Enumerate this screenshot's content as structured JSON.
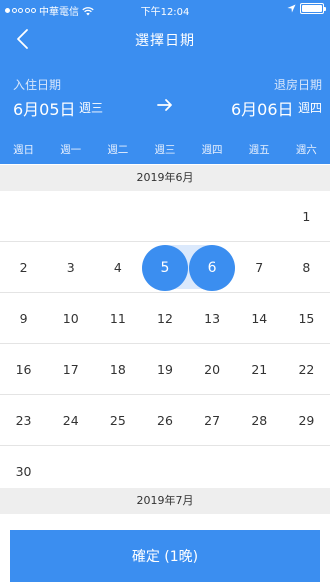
{
  "status_bar": {
    "carrier": "中華電信",
    "time": "下午12:04"
  },
  "nav": {
    "title": "選擇日期"
  },
  "stay": {
    "checkin_label": "入住日期",
    "checkin_date": "6月05日",
    "checkin_weekday": "週三",
    "checkout_label": "退房日期",
    "checkout_date": "6月06日",
    "checkout_weekday": "週四"
  },
  "weekdays": [
    "週日",
    "週一",
    "週二",
    "週三",
    "週四",
    "週五",
    "週六"
  ],
  "month1": {
    "label": "2019年6月",
    "weeks": [
      [
        "",
        "",
        "",
        "",
        "",
        "",
        "1"
      ],
      [
        "2",
        "3",
        "4",
        "5",
        "6",
        "7",
        "8"
      ],
      [
        "9",
        "10",
        "11",
        "12",
        "13",
        "14",
        "15"
      ],
      [
        "16",
        "17",
        "18",
        "19",
        "20",
        "21",
        "22"
      ],
      [
        "23",
        "24",
        "25",
        "26",
        "27",
        "28",
        "29"
      ],
      [
        "30",
        "",
        "",
        "",
        "",
        "",
        ""
      ]
    ],
    "selected": [
      "5",
      "6"
    ]
  },
  "month2": {
    "label": "2019年7月"
  },
  "confirm_button": {
    "label": "確定 (1晚)"
  },
  "colors": {
    "accent": "#3b8ef0",
    "range": "#dbe9fc",
    "month_header_bg": "#eeeeee"
  }
}
